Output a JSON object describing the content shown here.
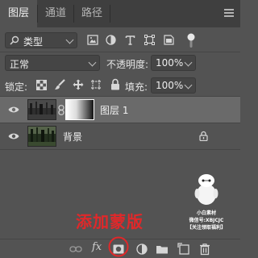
{
  "tabs": [
    {
      "label": "图层",
      "active": true
    },
    {
      "label": "通道",
      "active": false
    },
    {
      "label": "路径",
      "active": false
    }
  ],
  "filter": {
    "kind_label": "类型"
  },
  "blend": {
    "mode": "正常",
    "opacity_label": "不透明度:",
    "opacity_value": "100%"
  },
  "lock": {
    "label": "锁定:",
    "fill_label": "填充:",
    "fill_value": "100%"
  },
  "layers": [
    {
      "name": "图层 1",
      "selected": true,
      "has_mask": true,
      "locked": false
    },
    {
      "name": "背景",
      "selected": false,
      "has_mask": false,
      "locked": true
    }
  ],
  "annotation": {
    "text": "添加蒙版",
    "color": "#e0282a"
  },
  "watermark": {
    "line1": "小白素材",
    "line2": "微信号:XBJCJC",
    "line3": "【关注领取福利】"
  },
  "footer": {
    "fx_label": "fx"
  },
  "colors": {
    "panel": "#535353",
    "tabbar": "#3f3f3f",
    "selected_row": "#6a6a6a",
    "accent_red": "#e0282a"
  }
}
